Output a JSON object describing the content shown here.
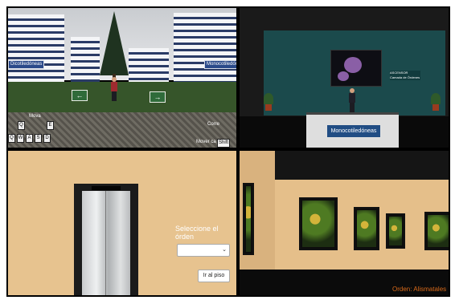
{
  "campus": {
    "sign_left": "Dicotiledóneas",
    "sign_right": "Monocotiledóneas",
    "label_top_left": "Mova",
    "label_right": "Corre",
    "label_bottom_right": "Mover ca",
    "btn_right": "Shift",
    "keys": [
      "Q",
      "E",
      "Q",
      "W",
      "A",
      "S",
      "D"
    ]
  },
  "reception": {
    "desk_label": "Monocotiledóneas",
    "elevator_sign_line1": "ASCENSOR",
    "elevator_sign_line2": "Camada de Órdenes"
  },
  "elevator": {
    "prompt": "Seleccione el órden",
    "select_value": "",
    "select_icon": "chevron-down-icon",
    "button_label": "Ir al piso"
  },
  "gallery": {
    "caption": "Orden: Alismatales"
  },
  "colors": {
    "lawn": "#36552a",
    "teal_wall": "#1b4a4c",
    "warm_wall": "#e7c38f",
    "accent_caption": "#d96a1a"
  }
}
